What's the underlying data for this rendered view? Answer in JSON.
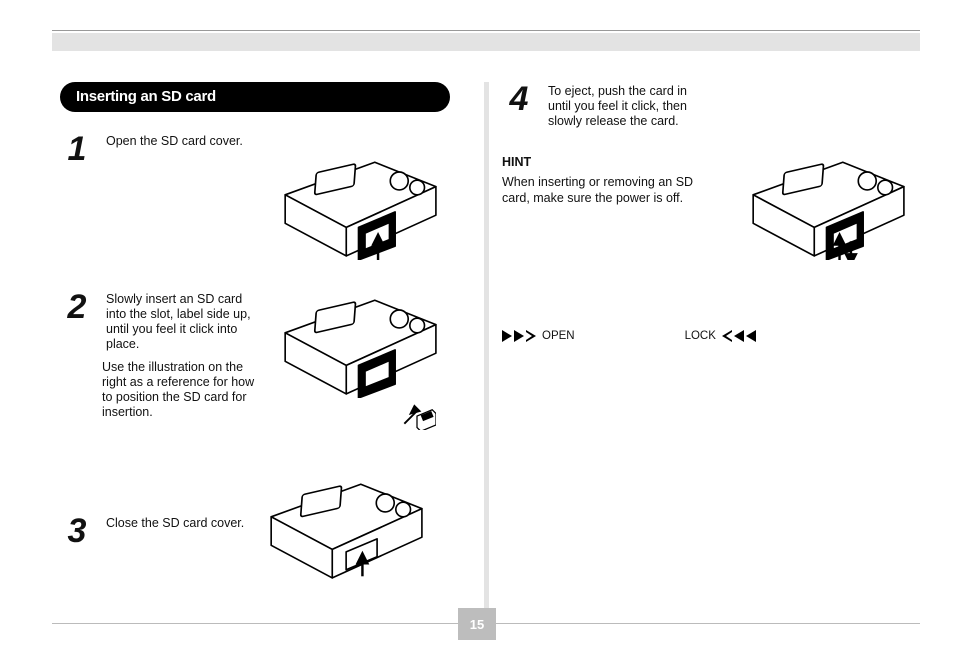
{
  "page_number": "15",
  "section_title": "Inserting an SD card",
  "steps": {
    "1": {
      "num": "1",
      "text": "Open the SD card cover."
    },
    "2": {
      "num": "2",
      "text": "Slowly insert an SD card into the slot, label side up, until you feel it click into place.",
      "sub": "Use the illustration on the right as a reference for how to position the SD card for insertion."
    },
    "3": {
      "num": "3",
      "text": "Close the SD card cover."
    },
    "4": {
      "num": "4",
      "text": "To eject, push the card in until you feel it click, then slowly release the card."
    }
  },
  "hint": {
    "title": "HINT",
    "body": "When inserting or removing an SD card, make sure the power is off."
  },
  "arrows": {
    "open": "OPEN",
    "lock": "LOCK"
  }
}
